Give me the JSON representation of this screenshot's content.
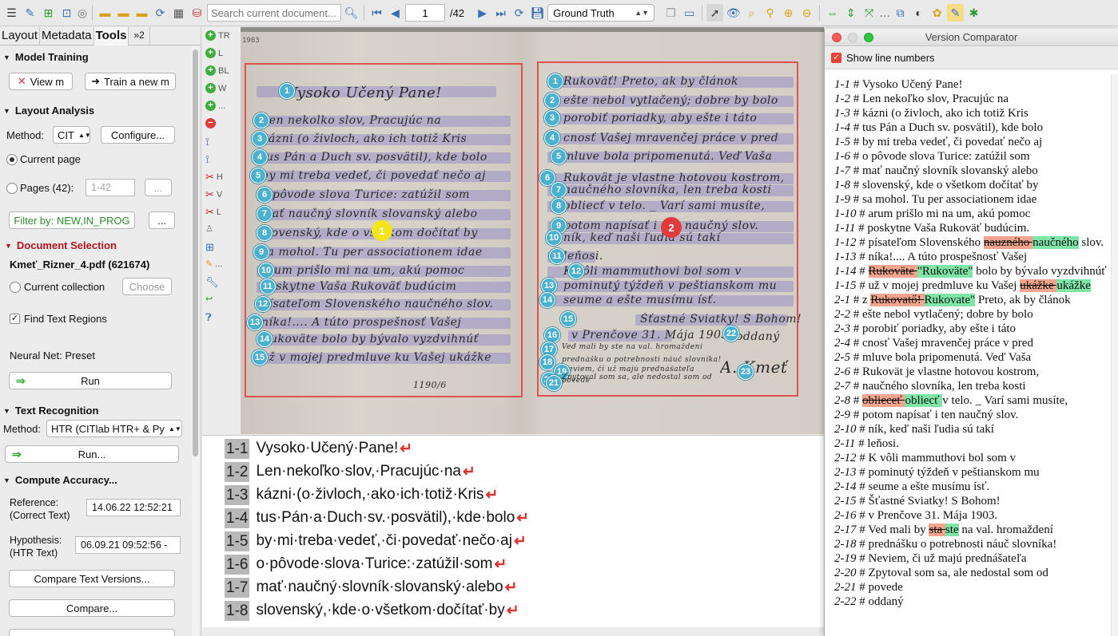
{
  "toolbar": {
    "search_placeholder": "Search current document...",
    "page_current": "1",
    "page_total": "/42",
    "version_selected": "Ground Truth"
  },
  "left": {
    "tabs": [
      "Layout",
      "Metadata",
      "Tools",
      "»2"
    ],
    "model_training": {
      "title": "Model Training",
      "view_btn": "View m",
      "train_btn": "Train a new m"
    },
    "layout_analysis": {
      "title": "Layout Analysis",
      "method_label": "Method:",
      "method_value": "CIT",
      "configure_btn": "Configure...",
      "current_page": "Current page",
      "pages": "Pages (42):",
      "pages_range": "1-42",
      "pages_more": "...",
      "filter_btn": "Filter by: NEW,IN_PROG",
      "filter_more": "..."
    },
    "document_selection": {
      "title": "Document Selection",
      "file": "Kmeť_Rizner_4.pdf (621674)",
      "current_collection": "Current collection",
      "choose_btn": "Choose"
    },
    "find_text_regions": "Find Text Regions",
    "neural_net": "Neural Net: Preset",
    "run_btn": "Run",
    "text_recognition": {
      "title": "Text Recognition",
      "method_label": "Method:",
      "method_value": "HTR (CITlab HTR+ & Py",
      "run_btn": "Run..."
    },
    "compute_accuracy": {
      "title": "Compute Accuracy...",
      "reference_label": "Reference:",
      "reference_sub": "(Correct Text)",
      "reference_value": "14.06.22 12:52:21",
      "hypothesis_label": "Hypothesis:",
      "hypothesis_sub": "(HTR Text)",
      "hypothesis_value": "06.09.21 09:52:56 -",
      "compare_versions_btn": "Compare Text Versions...",
      "compare_btn": "Compare..."
    }
  },
  "tool_column": [
    "TR",
    "L",
    "BL",
    "W",
    "...",
    "H",
    "V",
    "L",
    "..."
  ],
  "document": {
    "page_marker": "1903",
    "page_footer": "1190/6",
    "region_labels": [
      "1",
      "2"
    ],
    "left_lines": [
      "Vysoko Učený Pane!",
      "Len nekolko slov, Pracujúc na",
      "kázni (o živloch, ako ich totiž Kris",
      "tus Pán a Duch sv. posvätil), kde bolo",
      "by mi treba vedeť, či povedať nečo aj",
      "o pôvode slova Turice: zatúžil som",
      "mať naučný slovník slovanský alebo",
      "slovenský, kde o všetkom dočítať by",
      "sa mohol. Tu per associationem idae",
      "arum prišlo mi na um, akú pomoc",
      "poskytne Vaša Rukoväť budúcim",
      "písateľom Slovenského naučného slov.",
      "níka!.... A túto prospešnosť Vašej",
      "Rukoväte bolo by bývalo vyzdvihnúť",
      "už v mojej predmluve ku Vašej ukážke"
    ],
    "right_lines": [
      "Rukoväť! Preto, ak by článok",
      "ešte nebol vytlačený; dobre by bolo",
      "porobiť poriadky, aby ešte i táto",
      "cnosť Vašej mravenčej práce v pred",
      "mluve bola pripomenutá. Veď Vaša",
      "Rukovät je vlastne hotovou kostrom,",
      "naučného slovníka, len treba kosti",
      "obliecť v telo. _ Varí sami musíte,",
      "potom napísať i ten naučný slov.",
      "ník, keď naši ľudia sú takí",
      "leňosi.",
      "K vôli mammuthovi bol som v",
      "pominutý týždeň v peštianskom mu",
      "seume a ešte musímu ísť.",
      "Šťastné Sviatky! S Bohom!",
      "v Prenčove 31. Mája 1903.",
      "Ved mali by ste na val. hromaždení",
      "prednášku o potrebnosti náuč slovníka!",
      "Neviem, či už majú prednášateľa",
      "Zpytoval som sa, ale nedostal som od",
      "povede",
      "oddaný",
      "A. Kmeť"
    ],
    "right_nums": [
      "1",
      "2",
      "3",
      "4",
      "5",
      "6",
      "7",
      "8",
      "9",
      "10",
      "11",
      "12",
      "13",
      "14",
      "15",
      "16",
      "17",
      "18",
      "19",
      "20",
      "21",
      "22",
      "23"
    ]
  },
  "transcript": [
    {
      "id": "1-1",
      "text": "Vysoko·Učený·Pane!"
    },
    {
      "id": "1-2",
      "text": "Len·nekoľko·slov,·Pracujúc·na"
    },
    {
      "id": "1-3",
      "text": "kázni·(o·živloch,·ako·ich·totiž·Kris"
    },
    {
      "id": "1-4",
      "text": "tus·Pán·a·Duch·sv.·posvätil),·kde·bolo"
    },
    {
      "id": "1-5",
      "text": "by·mi·treba·vedeť,·či·povedať·nečo·aj"
    },
    {
      "id": "1-6",
      "text": "o·pôvode·slova·Turice:·zatúžil·som"
    },
    {
      "id": "1-7",
      "text": "mať·naučný·slovník·slovanský·alebo"
    },
    {
      "id": "1-8",
      "text": "slovenský,·kde·o·všetkom·dočítať·by"
    }
  ],
  "comparator": {
    "title": "Version Comparator",
    "show_line_numbers": "Show line numbers",
    "lines": [
      {
        "id": "1-1",
        "sep": " # ",
        "parts": [
          {
            "t": "Vysoko Učený Pane!"
          }
        ]
      },
      {
        "id": "1-2",
        "sep": " # ",
        "parts": [
          {
            "t": "Len nekoľko slov, Pracujúc na"
          }
        ]
      },
      {
        "id": "1-3",
        "sep": " # ",
        "parts": [
          {
            "t": "kázni (o živloch, ako ich totiž Kris"
          }
        ]
      },
      {
        "id": "1-4",
        "sep": " # ",
        "parts": [
          {
            "t": "tus Pán a Duch sv. posvätil), kde bolo"
          }
        ]
      },
      {
        "id": "1-5",
        "sep": " # ",
        "parts": [
          {
            "t": "by mi treba vedeť, či povedať nečo aj"
          }
        ]
      },
      {
        "id": "1-6",
        "sep": " # ",
        "parts": [
          {
            "t": "o pôvode slova Turice: zatúžil som"
          }
        ]
      },
      {
        "id": "1-7",
        "sep": " # ",
        "parts": [
          {
            "t": "mať naučný slovník slovanský alebo"
          }
        ]
      },
      {
        "id": "1-8",
        "sep": " # ",
        "parts": [
          {
            "t": "slovenský, kde o všetkom dočítať by"
          }
        ]
      },
      {
        "id": "1-9",
        "sep": " # ",
        "parts": [
          {
            "t": "sa mohol. Tu per associationem idae"
          }
        ]
      },
      {
        "id": "1-10",
        "sep": " # ",
        "parts": [
          {
            "t": "arum prišlo mi na um, akú pomoc"
          }
        ]
      },
      {
        "id": "1-11",
        "sep": " # ",
        "parts": [
          {
            "t": "poskytne Vaša Rukoväť budúcim."
          }
        ]
      },
      {
        "id": "1-12",
        "sep": " # ",
        "parts": [
          {
            "t": "písateľom Slovenského "
          },
          {
            "t": "nauzného ",
            "k": "del"
          },
          {
            "t": "naučného",
            "k": "ins"
          },
          {
            "t": " slov."
          }
        ]
      },
      {
        "id": "1-13",
        "sep": " # ",
        "parts": [
          {
            "t": "níka!.... A túto prospešnosť Vašej"
          }
        ]
      },
      {
        "id": "1-14",
        "sep": " # ",
        "parts": [
          {
            "t": "Rukoväte ",
            "k": "del"
          },
          {
            "t": "\"Rukoväte\"",
            "k": "ins"
          },
          {
            "t": " bolo by bývalo vyzdvihnúť"
          }
        ]
      },
      {
        "id": "1-15",
        "sep": " # ",
        "parts": [
          {
            "t": "už v mojej predmluve ku Vašej "
          },
          {
            "t": "ukážke ",
            "k": "del"
          },
          {
            "t": "ukážke ",
            "k": "ins"
          }
        ]
      },
      {
        "id": "2-1",
        "sep": " # ",
        "parts": [
          {
            "t": "z "
          },
          {
            "t": "Rukovatő! ",
            "k": "del"
          },
          {
            "t": "Rukovate\"",
            "k": "ins"
          },
          {
            "t": " Preto, ak by článok"
          }
        ]
      },
      {
        "id": "2-2",
        "sep": " # ",
        "parts": [
          {
            "t": "ešte nebol vytlačený; dobre by bolo"
          }
        ]
      },
      {
        "id": "2-3",
        "sep": " # ",
        "parts": [
          {
            "t": "porobiť poriadky, aby ešte i táto"
          }
        ]
      },
      {
        "id": "2-4",
        "sep": " # ",
        "parts": [
          {
            "t": "cnosť Vašej mravenčej práce v pred"
          }
        ]
      },
      {
        "id": "2-5",
        "sep": " # ",
        "parts": [
          {
            "t": "mluve bola pripomenutá. Veď Vaša"
          }
        ]
      },
      {
        "id": "2-6",
        "sep": " # ",
        "parts": [
          {
            "t": "Rukovät je vlastne hotovou kostrom,"
          }
        ]
      },
      {
        "id": "2-7",
        "sep": " # ",
        "parts": [
          {
            "t": "naučného slovníka, len treba kosti"
          }
        ]
      },
      {
        "id": "2-8",
        "sep": " # ",
        "parts": [
          {
            "t": "oblieceť ",
            "k": "del"
          },
          {
            "t": "obliecť ",
            "k": "ins"
          },
          {
            "t": " v telo. _ Varí sami musíte,"
          }
        ]
      },
      {
        "id": "2-9",
        "sep": " # ",
        "parts": [
          {
            "t": "potom napísať i ten naučný slov."
          }
        ]
      },
      {
        "id": "2-10",
        "sep": " # ",
        "parts": [
          {
            "t": "ník, keď naši ľudia sú takí"
          }
        ]
      },
      {
        "id": "2-11",
        "sep": " # ",
        "parts": [
          {
            "t": "leňosi."
          }
        ]
      },
      {
        "id": "2-12",
        "sep": " # ",
        "parts": [
          {
            "t": "K vôli mammuthovi bol som v"
          }
        ]
      },
      {
        "id": "2-13",
        "sep": " # ",
        "parts": [
          {
            "t": "pominutý týždeň v peštianskom mu"
          }
        ]
      },
      {
        "id": "2-14",
        "sep": " # ",
        "parts": [
          {
            "t": "seume a ešte musímu ísť."
          }
        ]
      },
      {
        "id": "2-15",
        "sep": " # ",
        "parts": [
          {
            "t": "Šťastné Sviatky! S Bohom!"
          }
        ]
      },
      {
        "id": "2-16",
        "sep": " # ",
        "parts": [
          {
            "t": "v Prenčove 31. Mája 1903."
          }
        ]
      },
      {
        "id": "2-17",
        "sep": " # ",
        "parts": [
          {
            "t": "Ved mali by "
          },
          {
            "t": "sta ",
            "k": "del"
          },
          {
            "t": "ste",
            "k": "ins"
          },
          {
            "t": " na val. hromaždení"
          }
        ]
      },
      {
        "id": "2-18",
        "sep": " # ",
        "parts": [
          {
            "t": "prednášku o potrebnosti náuč slovníka!"
          }
        ]
      },
      {
        "id": "2-19",
        "sep": " # ",
        "parts": [
          {
            "t": "Neviem, či už majú prednášateľa"
          }
        ]
      },
      {
        "id": "2-20",
        "sep": " # ",
        "parts": [
          {
            "t": "Zpytoval som sa, ale nedostal som od"
          }
        ]
      },
      {
        "id": "2-21",
        "sep": " # ",
        "parts": [
          {
            "t": "povede"
          }
        ]
      },
      {
        "id": "2-22",
        "sep": " # ",
        "parts": [
          {
            "t": "oddaný"
          }
        ]
      }
    ]
  },
  "colors": {
    "region_border": "#e05252",
    "line_overlay": "#7868c8",
    "line_number": "#4ab2cf",
    "deletion": "#f2a48e",
    "insertion": "#7fe5a6",
    "label_red": "#b3141c"
  }
}
